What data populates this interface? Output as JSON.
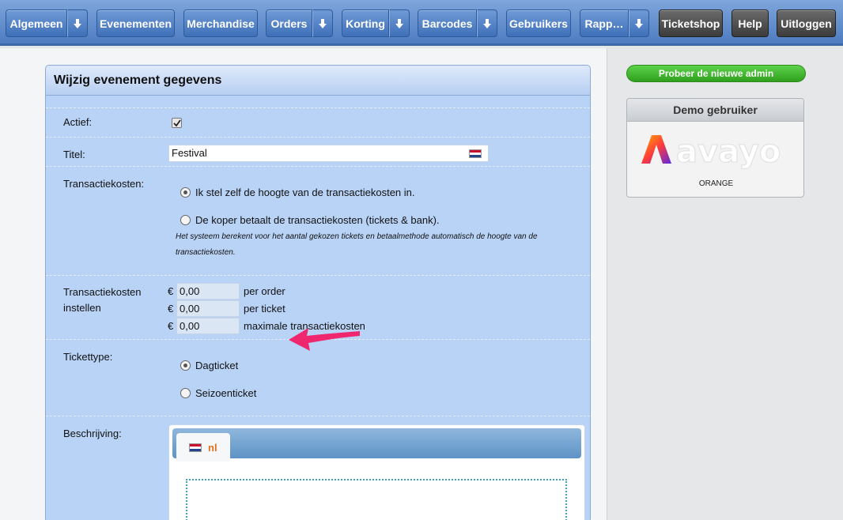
{
  "nav": {
    "items": [
      {
        "label": "Algemeen"
      },
      {
        "label": "Evenementen"
      },
      {
        "label": "Merchandise"
      },
      {
        "label": "Orders"
      },
      {
        "label": "Korting"
      },
      {
        "label": "Barcodes"
      },
      {
        "label": "Gebruikers"
      },
      {
        "label": "Rapp…"
      }
    ],
    "ticketshop": "Ticketshop",
    "help": "Help",
    "logout": "Uitloggen"
  },
  "panel": {
    "title": "Wijzig evenement gegevens",
    "actief_label": "Actief:",
    "actief_checked": true,
    "titel_label": "Titel:",
    "titel_value": "Festival",
    "tk_label": "Transactiekosten:",
    "tk_option1": "Ik stel zelf de hoogte van de transactiekosten in.",
    "tk_option2": "De koper betaalt de transactiekosten (tickets & bank).",
    "tk_help": "Het systeem berekent voor het aantal gekozen tickets en betaalmethode automatisch de hoogte van de transactiekosten.",
    "tki_label1": "Transactiekosten",
    "tki_label2": "instellen",
    "currency": "€",
    "per_order_value": "0,00",
    "per_order_label": "per order",
    "per_ticket_value": "0,00",
    "per_ticket_label": "per ticket",
    "max_value": "0,00",
    "max_label": "maximale transactiekosten",
    "tickettype_label": "Tickettype:",
    "tickettype_option1": "Dagticket",
    "tickettype_option2": "Seizoenticket",
    "beschrijving_label": "Beschrijving:",
    "lang_tab": "nl"
  },
  "sidebar": {
    "try_admin": "Probeer de nieuwe admin",
    "demo_title": "Demo gebruiker",
    "logo_text": "avayo",
    "logo_sub": "ORANGE"
  },
  "colors": {
    "nav_blue": "#4d7cc0",
    "panel_blue": "#b9d3f6",
    "annotation_arrow": "#f0266e",
    "try_admin_green": "#2fa01e"
  }
}
